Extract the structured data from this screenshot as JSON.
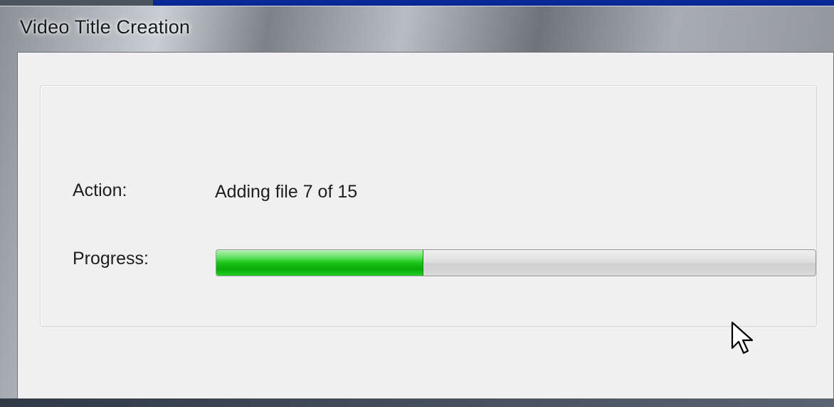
{
  "window": {
    "title": "Video Title Creation"
  },
  "status": {
    "action_label": "Action:",
    "action_value": "Adding file 7 of 15",
    "progress_label": "Progress:",
    "progress_fraction": 0.345
  },
  "colors": {
    "progress_green": "#18c418",
    "client_bg": "#f0f0f0"
  },
  "icons": {
    "cursor": "mouse-pointer-icon"
  }
}
